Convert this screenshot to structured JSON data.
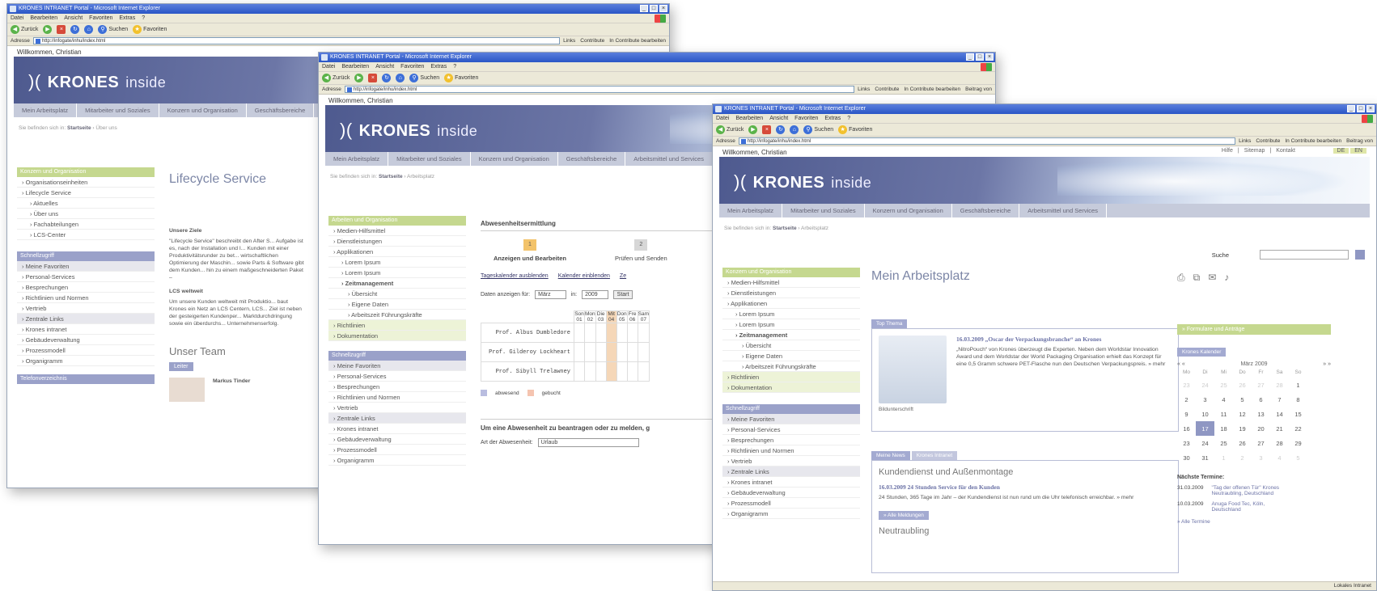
{
  "browser": {
    "title": "KRONES INTRANET Portal - Microsoft Internet Explorer",
    "menu": [
      "Datei",
      "Bearbeiten",
      "Ansicht",
      "Favoriten",
      "Extras",
      "?"
    ],
    "toolbar": {
      "back": "Zurück",
      "search": "Suchen",
      "favorites": "Favoriten"
    },
    "address_label": "Adresse",
    "address": "http://infogate/inhu/index.html",
    "links": [
      "Links",
      "Contribute",
      "In Contribute bearbeiten",
      "Beitrag von"
    ],
    "status_right": "Lokales Intranet"
  },
  "portal": {
    "welcome": "Willkommen, Christian",
    "util_nav": [
      "Hilfe",
      "Sitemap",
      "Kontakt"
    ],
    "lang": [
      "DE",
      "EN"
    ],
    "logo_mark": ")(",
    "logo_name": "KRONES",
    "logo_sub": "inside",
    "main_nav": [
      "Mein Arbeitsplatz",
      "Mitarbeiter und Soziales",
      "Konzern und Organisation",
      "Geschäftsbereiche",
      "Arbeitsmittel und Services"
    ],
    "breadcrumb_prefix": "Sie befinden sich in:",
    "breadcrumb_home": "Startseite"
  },
  "window1": {
    "breadcrumb_current": "Über uns",
    "nav_head": "Konzern und Organisation",
    "nav_items": [
      "Organisationseinheiten",
      "Lifecycle Service",
      "Aktuelles",
      "Über uns",
      "Fachabteilungen",
      "LCS-Center"
    ],
    "quick_head": "Schnellzugriff",
    "quick_items": [
      "Meine Favoriten",
      "Personal-Services",
      "Besprechungen",
      "Richtlinien und Normen",
      "Vertrieb",
      "Zentrale Links",
      "Krones intranet",
      "Gebäudeverwaltung",
      "Prozessmodell",
      "Organigramm"
    ],
    "tel_head": "Telefonverzeichnis",
    "page_title": "Lifecycle Service",
    "goals_head": "Unsere Ziele",
    "goals_text": "\"Lifecycle Service\" beschreibt den After S... Aufgabe ist es, nach der Installation und I... Kunden mit einer Produktivitätsrunder zu bet... wirtschaftlichen Optimierung der Maschin... sowie Parts & Software gibt dem Kunden... hin zu einem maßgeschneiderten Paket –",
    "lcs_head": "LCS weltweit",
    "lcs_text": "Um unsere Kunden weltweit mit Produktio... baut Krones ein Netz an LCS Centern, LCS... Ziel ist neben der gesteigerten Kundenper... Marktdurchdringung sowie ein überdurchs... Unternehmenserfolg.",
    "team_title": "Unser Team",
    "team_tab": "Leiter",
    "person_name": "Markus Tinder"
  },
  "window2": {
    "breadcrumb_current": "Arbeitsplatz",
    "nav_head": "Arbeiten und Organisation",
    "nav_items": [
      "Medien-Hilfsmittel",
      "Dienstleistungen",
      "Applikationen",
      "Lorem Ipsum",
      "Lorem Ipsum",
      "Zeitmanagement",
      "Übersicht",
      "Eigene Daten",
      "Arbeitszeit Führungskräfte",
      "Richtlinien",
      "Dokumentation"
    ],
    "quick_head": "Schnellzugriff",
    "quick_items": [
      "Meine Favoriten",
      "Personal-Services",
      "Besprechungen",
      "Richtlinien und Normen",
      "Vertrieb",
      "Zentrale Links",
      "Krones intranet",
      "Gebäudeverwaltung",
      "Prozessmodell",
      "Organigramm"
    ],
    "panel_title": "Abwesenheitsermittlung",
    "steps": [
      {
        "num": "1",
        "label": "Anzeigen und Bearbeiten"
      },
      {
        "num": "2",
        "label": "Prüfen und Senden"
      }
    ],
    "links": [
      "Tageskalender ausblenden",
      "Kalender einblenden",
      "Ze"
    ],
    "filter_label": "Daten anzeigen für:",
    "month": "März",
    "year_label": "in:",
    "year": "2009",
    "start_btn": "Start",
    "day_names": [
      "Son",
      "Mon",
      "Die",
      "Mit",
      "Don",
      "Fre",
      "Sam"
    ],
    "day_nums": [
      "01",
      "02",
      "03",
      "04",
      "05",
      "06",
      "07"
    ],
    "people": [
      "Prof. Albus Dumbledore",
      "Prof. Gilderoy Lockheart",
      "Prof. Sibyll Trelawney"
    ],
    "legend": [
      "abwesend",
      "gebucht"
    ],
    "request_head": "Um eine Abwesenheit zu beantragen oder zu melden, g",
    "type_label": "Art der Abwesenheit:",
    "type_value": "Urlaub"
  },
  "window3": {
    "breadcrumb_current": "Arbeitsplatz",
    "nav_head": "Konzern und Organisation",
    "nav_items": [
      "Medien-Hilfsmittel",
      "Dienstleistungen",
      "Applikationen",
      "Lorem Ipsum",
      "Lorem Ipsum",
      "Zeitmanagement",
      "Übersicht",
      "Eigene Daten",
      "Arbeitszeit Führungskräfte",
      "Richtlinien",
      "Dokumentation"
    ],
    "quick_head": "Schnellzugriff",
    "quick_items": [
      "Meine Favoriten",
      "Personal-Services",
      "Besprechungen",
      "Richtlinien und Normen",
      "Vertrieb",
      "Zentrale Links",
      "Krones intranet",
      "Gebäudeverwaltung",
      "Prozessmodell",
      "Organigramm"
    ],
    "page_title": "Mein Arbeitsplatz",
    "top_theme_tab": "Top Thema",
    "top_headline": "16.03.2009 „Oscar der Verpackungsbranche“ an Krones",
    "top_text": "„NitroPouch“ von Krones überzeugt die Experten. Neben dem Worldstar Innovation Award und dem Worldstar der World Packaging Organisation erhielt das Konzept für eine 0,5 Gramm schwere PET-Flasche nun den Deutschen Verpackungspreis. » mehr",
    "caption": "Bildunterschrift",
    "news_tabs": [
      "Meine News",
      "Krones Intranet"
    ],
    "news_section": "Kundendienst und Außenmontage",
    "news_headline": "16.03.2009 24 Stunden Service für den Kunden",
    "news_text": "24 Stunden, 365 Tage im Jahr – der Kundendienst ist nun rund um die Uhr telefonisch erreichbar. » mehr",
    "news_btn": "» Alle Meldungen",
    "section2": "Neutraubling",
    "search_label": "Suche",
    "formulare": "» Formulare und Anträge",
    "kal_head": "Krones Kalender",
    "kal_month": "März 2009",
    "kal_days": [
      "Mo",
      "Di",
      "Mi",
      "Do",
      "Fr",
      "Sa",
      "So"
    ],
    "kal_weeks": [
      [
        "23",
        "24",
        "25",
        "26",
        "27",
        "28",
        "1"
      ],
      [
        "2",
        "3",
        "4",
        "5",
        "6",
        "7",
        "8"
      ],
      [
        "9",
        "10",
        "11",
        "12",
        "13",
        "14",
        "15"
      ],
      [
        "16",
        "17",
        "18",
        "19",
        "20",
        "21",
        "22"
      ],
      [
        "23",
        "24",
        "25",
        "26",
        "27",
        "28",
        "29"
      ],
      [
        "30",
        "31",
        "1",
        "2",
        "3",
        "4",
        "5"
      ]
    ],
    "next_head": "Nächste Termine:",
    "events": [
      {
        "date": "31.03.2009",
        "text": "\"Tag der offenen Tür\" Krones Neutraubling, Deutschland"
      },
      {
        "date": "10.03.2009",
        "text": "Anuga Food Tec, Köln, Deutschland"
      }
    ],
    "all_events": "» Alle Termine"
  }
}
